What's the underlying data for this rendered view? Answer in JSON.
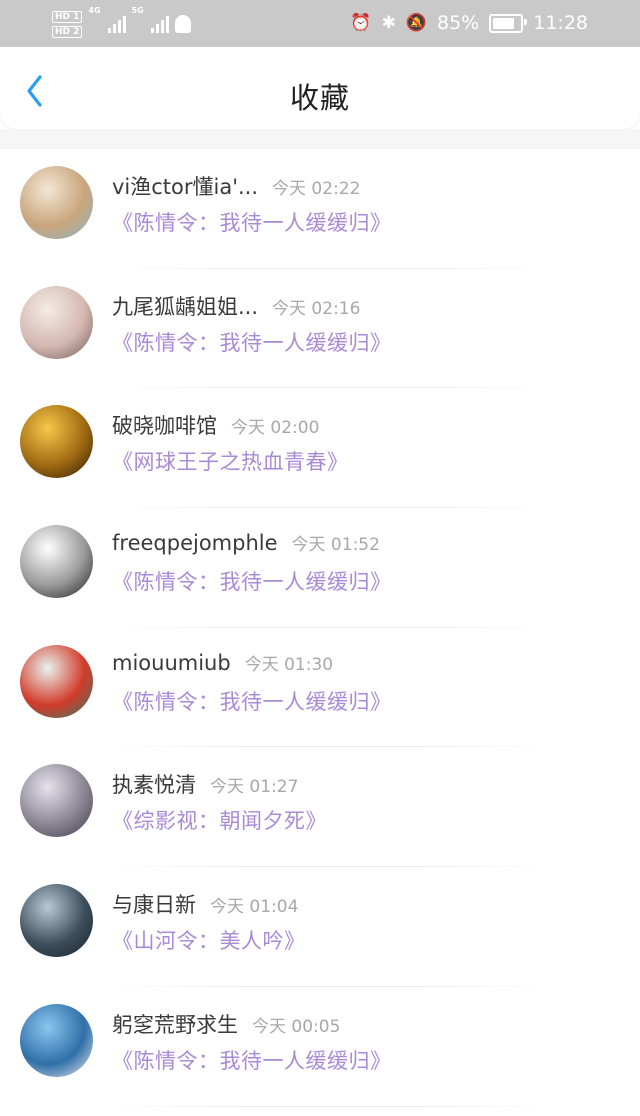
{
  "status_bar": {
    "hd_top": "HD 1",
    "hd_bottom": "HD 2",
    "net1": "4G",
    "net2": "5G",
    "battery_pct": "85%",
    "time": "11:28"
  },
  "header": {
    "title": "收藏"
  },
  "favorites": [
    {
      "name": "vi渔ctor懂ia'...",
      "time": "今天 02:22",
      "book": "《陈情令：我待一人缓缓归》",
      "avatar_colors": [
        "#f3e7d6",
        "#c9a57c",
        "#86b6c8"
      ]
    },
    {
      "name": "九尾狐龋姐姐...",
      "time": "今天 02:16",
      "book": "《陈情令：我待一人缓缓归》",
      "avatar_colors": [
        "#f4ece8",
        "#d4b8b0",
        "#6e5a58"
      ]
    },
    {
      "name": "破晓咖啡馆",
      "time": "今天 02:00",
      "book": "《网球王子之热血青春》",
      "avatar_colors": [
        "#f6c84a",
        "#a06a12",
        "#2a1a08"
      ]
    },
    {
      "name": "freeqpejomphle",
      "time": "今天 01:52",
      "book": "《陈情令：我待一人缓缓归》",
      "avatar_colors": [
        "#ffffff",
        "#9a9a9a",
        "#1a1a1a"
      ]
    },
    {
      "name": "miouumiub",
      "time": "今天 01:30",
      "book": "《陈情令：我待一人缓缓归》",
      "avatar_colors": [
        "#e9f3ef",
        "#d23b2a",
        "#2f7f6a"
      ]
    },
    {
      "name": "执素悦清",
      "time": "今天 01:27",
      "book": "《综影视：朝闻夕死》",
      "avatar_colors": [
        "#e6e3ec",
        "#8b8594",
        "#3e3a47"
      ]
    },
    {
      "name": "与康日新",
      "time": "今天 01:04",
      "book": "《山河令：美人吟》",
      "avatar_colors": [
        "#b7c9d6",
        "#3d4f5c",
        "#15202a"
      ]
    },
    {
      "name": "躬窆荒野求生",
      "time": "今天 00:05",
      "book": "《陈情令：我待一人缓缓归》",
      "avatar_colors": [
        "#8cc6ef",
        "#2f6fa8",
        "#eeeeee"
      ]
    }
  ],
  "colors": {
    "accent_blue": "#2a9df4",
    "book_title_purple": "#a98ad7",
    "status_bar_gray": "#c9c9c9"
  }
}
